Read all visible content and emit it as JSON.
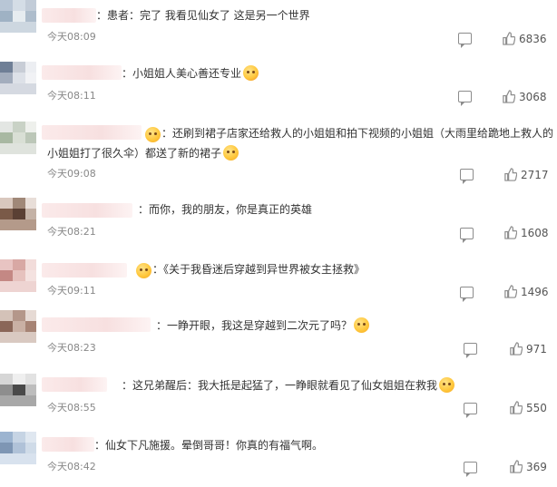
{
  "comments": [
    {
      "text": "：患者：完了 我看见仙女了 这是另一个世界",
      "time": "今天08:09",
      "likes": "6836",
      "emoji": ""
    },
    {
      "text": "：小姐姐人美心善还专业",
      "time": "今天08:11",
      "likes": "3068",
      "emoji": "party-emoji"
    },
    {
      "text": "：还刷到裙子店家还给救人的小姐姐和拍下视频的小姐姐（大雨里给跪地上救人的",
      "text2": "小姐姐打了很久伞）都送了新的裙子",
      "time": "今天09:08",
      "likes": "2717",
      "emoji": "kiss-emoji"
    },
    {
      "text": "：而你，我的朋友，你是真正的英雄",
      "time": "今天08:21",
      "likes": "1608",
      "emoji": ""
    },
    {
      "text": "：《关于我昏迷后穿越到异世界被女主拯救》",
      "time": "今天09:11",
      "likes": "1496",
      "emoji": ""
    },
    {
      "text": "：一睁开眼，我这是穿越到二次元了吗？",
      "time": "今天08:23",
      "likes": "971",
      "emoji": "surprised-emoji"
    },
    {
      "text": "：这兄弟醒后：我大抵是起猛了，一睁眼就看见了仙女姐姐在救我",
      "time": "今天08:55",
      "likes": "550",
      "emoji": "wow-emoji"
    },
    {
      "text": "：仙女下凡施援。晕倒哥哥！你真的有福气啊。",
      "time": "今天08:42",
      "likes": "369",
      "emoji": ""
    }
  ]
}
